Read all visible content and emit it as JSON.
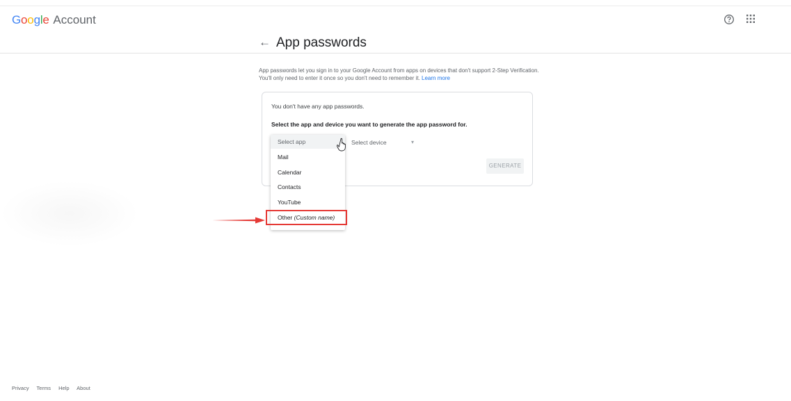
{
  "header": {
    "logo_google": "Google",
    "logo_account": "Account",
    "help_icon": "help-circle-icon",
    "apps_icon": "apps-grid-icon"
  },
  "page": {
    "back_icon": "back-arrow-icon",
    "title": "App passwords",
    "description": "App passwords let you sign in to your Google Account from apps on devices that don't support 2-Step Verification. You'll only need to enter it once so you don't need to remember it.",
    "learn_more": "Learn more"
  },
  "card": {
    "no_passwords": "You don't have any app passwords.",
    "instruction": "Select the app and device you want to generate the app password for.",
    "select_app_label": "Select app",
    "select_device_label": "Select device",
    "generate_label": "GENERATE"
  },
  "dropdown": {
    "items": [
      "Mail",
      "Calendar",
      "Contacts",
      "YouTube"
    ],
    "other_label": "Other",
    "other_hint": "(Custom name)"
  },
  "footer": {
    "links": [
      "Privacy",
      "Terms",
      "Help",
      "About"
    ]
  },
  "colors": {
    "accent": "#1a73e8",
    "annotation": "#e53935"
  }
}
